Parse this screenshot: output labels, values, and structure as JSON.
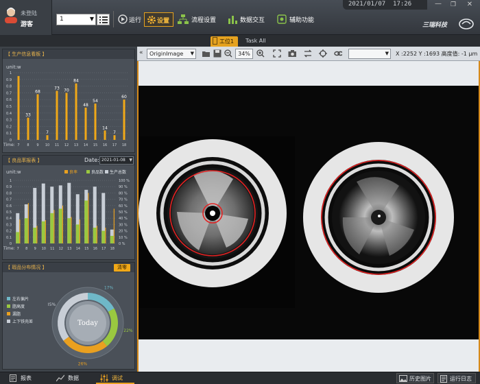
{
  "topbar": {
    "user_status": "未登陆",
    "user_name": "游客",
    "station_select": "1",
    "nav": {
      "run": "运行",
      "settings": "设置",
      "flow": "流程设置",
      "data_exchange": "数据交互",
      "aux": "辅助功能"
    },
    "datetime": "2021/01/07  17:26",
    "brand": "三瑞科技",
    "window_controls": [
      "minimize-icon",
      "restore-icon",
      "close-icon"
    ]
  },
  "station_tabs": [
    {
      "label": "工位1",
      "active": true
    },
    {
      "label": "Task All",
      "active": false
    }
  ],
  "production_panel": {
    "title": "【 生产信息看板 】",
    "unit": "unit:w",
    "time_label": "Time:",
    "chart_data": {
      "type": "bar",
      "categories": [
        "7",
        "8",
        "9",
        "10",
        "11",
        "12",
        "13",
        "14",
        "15",
        "16",
        "17",
        "18"
      ],
      "values": [
        95,
        33,
        68,
        7,
        73,
        70,
        84,
        48,
        54,
        14,
        7,
        60
      ],
      "ylim": [
        0,
        100
      ],
      "yticks": [
        "1",
        "0.9",
        "0.8",
        "0.7",
        "0.6",
        "0.5",
        "0.4",
        "0.3",
        "0.2",
        "0.1",
        "0"
      ],
      "labels": [
        "",
        "33",
        "68",
        "7",
        "73",
        "70",
        "84",
        "48",
        "54",
        "14",
        "7",
        "60"
      ],
      "bar_color": "#f0a818"
    }
  },
  "yield_panel": {
    "title": "【 良品率报表 】",
    "date_label": "Date:",
    "date_value": "2021-01-08",
    "unit": "unit:w",
    "time_label": "Time:",
    "legend": [
      {
        "label": "良率",
        "color": "#e9a020"
      },
      {
        "label": "良品数",
        "color": "#9ac840"
      },
      {
        "label": "生产总数",
        "color": "#c8ced6"
      }
    ],
    "chart_data": {
      "type": "bar",
      "categories": [
        "7",
        "8",
        "9",
        "10",
        "11",
        "12",
        "13",
        "14",
        "15",
        "16",
        "17",
        "18"
      ],
      "series": [
        {
          "name": "生产总数",
          "values": [
            48,
            62,
            88,
            95,
            90,
            92,
            96,
            78,
            85,
            90,
            80,
            22
          ]
        },
        {
          "name": "良品数",
          "values": [
            18,
            40,
            25,
            35,
            48,
            55,
            40,
            30,
            68,
            25,
            20,
            12
          ]
        },
        {
          "name": "良率",
          "values": [
            38,
            64,
            28,
            37,
            53,
            60,
            42,
            38,
            80,
            28,
            25,
            55
          ]
        }
      ],
      "ylim": [
        0,
        100
      ],
      "yticks_left": [
        "1",
        "0.9",
        "0.8",
        "0.7",
        "0.6",
        "0.5",
        "0.4",
        "0.3",
        "0.2",
        "0.1",
        "0"
      ],
      "yticks_right": [
        "100 %",
        "90 %",
        "80 %",
        "70 %",
        "60 %",
        "50 %",
        "40 %",
        "30 %",
        "20 %",
        "10 %",
        "0 %"
      ]
    }
  },
  "defect_panel": {
    "title": "【 瑕品分布情况 】",
    "clear_button": "清零",
    "legend": [
      {
        "label": "左右偏片",
        "color": "#6fb8c8"
      },
      {
        "label": "脂高度",
        "color": "#9ac840"
      },
      {
        "label": "漏脂",
        "color": "#e9a020"
      },
      {
        "label": "上下铁壳差",
        "color": "#c8ced6"
      }
    ],
    "center_text": "Today",
    "chart_data": {
      "type": "pie",
      "labels": [
        "左右偏片",
        "脂高度",
        "漏脂",
        "上下铁壳差"
      ],
      "values": [
        17,
        22,
        26,
        35
      ],
      "display_labels": [
        "17%",
        "22%",
        "26%",
        "35%"
      ]
    }
  },
  "image_toolbar": {
    "image_select": "OriginImage",
    "zoom": "34%",
    "empty_select": "",
    "coords": "X :2252 Y :1693 高度值: -1 μm"
  },
  "bottombar": {
    "left_tabs": [
      {
        "label": "报表"
      },
      {
        "label": "数据"
      },
      {
        "label": "调试",
        "active": true
      }
    ],
    "right_buttons": [
      {
        "label": "历史图片"
      },
      {
        "label": "运行日志"
      }
    ]
  }
}
